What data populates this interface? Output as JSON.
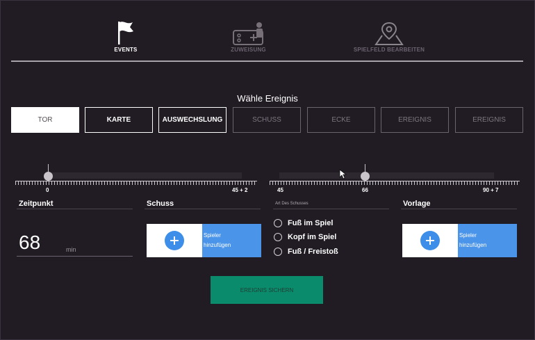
{
  "nav": {
    "events_label": "EVENTS",
    "assignment_label": "ZUWEISUNG",
    "field_label": "SPIELFELD BEARBEITEN",
    "active_icon": "flag-icon",
    "assignment_icon": "gamepad-person-icon",
    "field_icon": "map-pin-icon"
  },
  "event_section": {
    "title": "Wähle Ereignis",
    "types": [
      "TOR",
      "KARTE",
      "AUSWECHSLUNG",
      "SCHUSS",
      "ECKE",
      "EREIGNIS",
      "EREIGNIS"
    ],
    "selected": "TOR"
  },
  "timeline": {
    "first_half": {
      "start_label": "0",
      "end_label": "45 + 2",
      "value": 0
    },
    "second_half": {
      "start_label": "45",
      "end_label": "90 + 7",
      "marker_label": "66",
      "value": 66
    }
  },
  "form": {
    "time": {
      "title": "Zeitpunkt",
      "value": "68",
      "unit": "min"
    },
    "shot": {
      "title": "Schuss",
      "add_label_1": "Spieler",
      "add_label_2": "hinzufügen"
    },
    "shot_type": {
      "title": "Art Des Schusses",
      "options": [
        "Fuß im Spiel",
        "Kopf im Spiel",
        "Fuß / Freistoß"
      ]
    },
    "assist": {
      "title": "Vorlage",
      "add_label_1": "Spieler",
      "add_label_2": "hinzufügen"
    }
  },
  "actions": {
    "save_label": "EREIGNIS SICHERN"
  },
  "colors": {
    "background": "#211b23",
    "accent_blue": "#4a94ea",
    "save_green": "#0a8c6c"
  }
}
